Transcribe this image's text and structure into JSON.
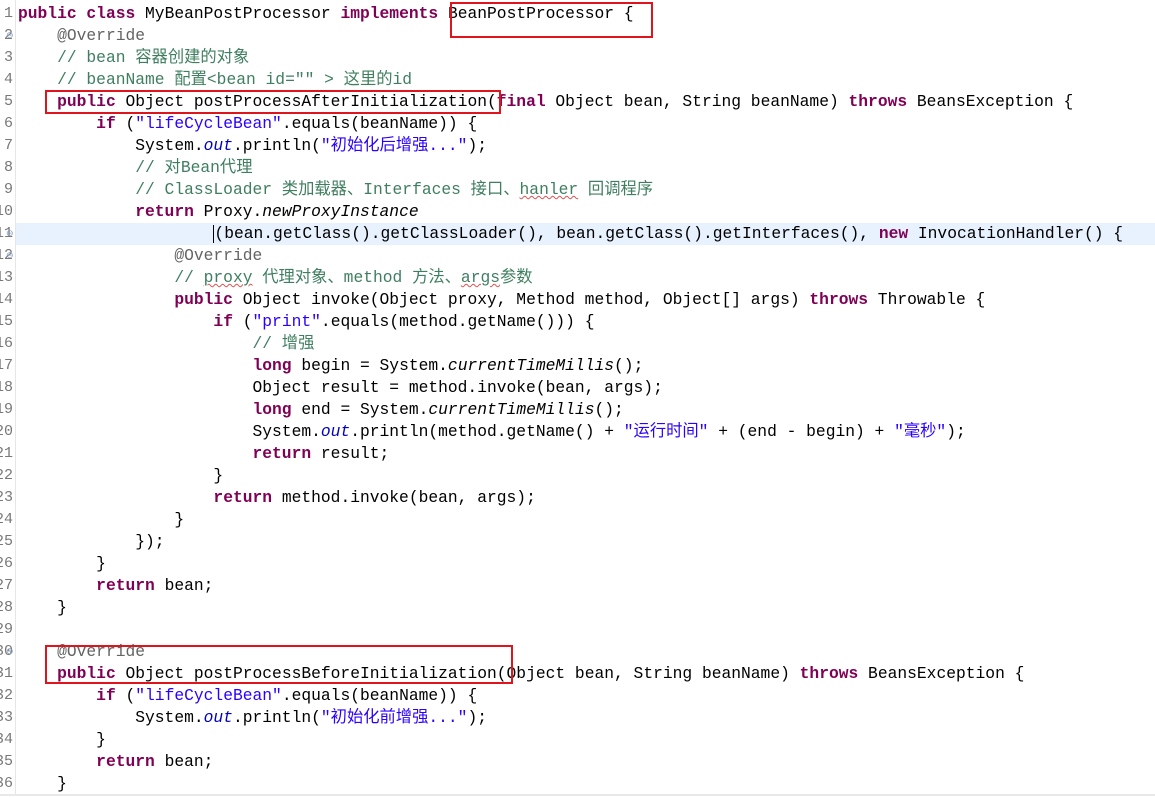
{
  "editor": {
    "current_line": 11,
    "colors": {
      "keyword": "#7f0055",
      "string": "#2a00ff",
      "comment": "#3f7f5f",
      "annotation": "#646464",
      "field": "#0000c0",
      "highlight_box": "#e0141c",
      "current_line_bg": "#e8f2fe"
    },
    "fold_lines": [
      2,
      11,
      12,
      30
    ],
    "lines": [
      {
        "n": "1",
        "t": [
          [
            "k",
            "public"
          ],
          [
            "t",
            " "
          ],
          [
            "k",
            "class"
          ],
          [
            "t",
            " MyBeanPostProcessor "
          ],
          [
            "k",
            "implements"
          ],
          [
            "t",
            " BeanPostProcessor {"
          ]
        ]
      },
      {
        "n": "2",
        "t": [
          [
            "t",
            "    "
          ],
          [
            "a",
            "@Override"
          ]
        ]
      },
      {
        "n": "3",
        "t": [
          [
            "t",
            "    "
          ],
          [
            "c",
            "// bean 容器创建的对象"
          ]
        ]
      },
      {
        "n": "4",
        "t": [
          [
            "t",
            "    "
          ],
          [
            "c",
            "// beanName 配置<bean id=\"\" > 这里的id"
          ]
        ]
      },
      {
        "n": "5",
        "t": [
          [
            "t",
            "    "
          ],
          [
            "k",
            "public"
          ],
          [
            "t",
            " Object postProcessAfterInitialization("
          ],
          [
            "k",
            "final"
          ],
          [
            "t",
            " Object bean, String beanName) "
          ],
          [
            "k",
            "throws"
          ],
          [
            "t",
            " BeansException {"
          ]
        ]
      },
      {
        "n": "6",
        "t": [
          [
            "t",
            "        "
          ],
          [
            "k",
            "if"
          ],
          [
            "t",
            " ("
          ],
          [
            "s",
            "\"lifeCycleBean\""
          ],
          [
            "t",
            ".equals(beanName)) {"
          ]
        ]
      },
      {
        "n": "7",
        "t": [
          [
            "t",
            "            System."
          ],
          [
            "f",
            "out"
          ],
          [
            "t",
            ".println("
          ],
          [
            "s",
            "\"初始化后增强...\""
          ],
          [
            "t",
            ");"
          ]
        ]
      },
      {
        "n": "8",
        "t": [
          [
            "t",
            "            "
          ],
          [
            "c",
            "// 对Bean代理"
          ]
        ]
      },
      {
        "n": "9",
        "t": [
          [
            "t",
            "            "
          ],
          [
            "c",
            "// ClassLoader 类加载器、Interfaces 接口、"
          ],
          [
            "typo",
            "hanler"
          ],
          [
            "c",
            " 回调程序"
          ]
        ]
      },
      {
        "n": "10",
        "t": [
          [
            "t",
            "            "
          ],
          [
            "k",
            "return"
          ],
          [
            "t",
            " Proxy."
          ],
          [
            "m",
            "newProxyInstance"
          ]
        ]
      },
      {
        "n": "11",
        "t": [
          [
            "t",
            "                    "
          ],
          [
            "caret",
            ""
          ],
          [
            "t",
            "(bean.getClass().getClassLoader(), bean.getClass().getInterfaces(), "
          ],
          [
            "k",
            "new"
          ],
          [
            "t",
            " InvocationHandler() {"
          ]
        ]
      },
      {
        "n": "12",
        "t": [
          [
            "t",
            "                "
          ],
          [
            "a",
            "@Override"
          ]
        ]
      },
      {
        "n": "13",
        "t": [
          [
            "t",
            "                "
          ],
          [
            "c",
            "// "
          ],
          [
            "typo",
            "proxy"
          ],
          [
            "c",
            " 代理对象、method 方法、"
          ],
          [
            "typo",
            "args"
          ],
          [
            "c",
            "参数"
          ]
        ]
      },
      {
        "n": "14",
        "t": [
          [
            "t",
            "                "
          ],
          [
            "k",
            "public"
          ],
          [
            "t",
            " Object invoke(Object proxy, Method method, Object[] args) "
          ],
          [
            "k",
            "throws"
          ],
          [
            "t",
            " Throwable {"
          ]
        ]
      },
      {
        "n": "15",
        "t": [
          [
            "t",
            "                    "
          ],
          [
            "k",
            "if"
          ],
          [
            "t",
            " ("
          ],
          [
            "s",
            "\"print\""
          ],
          [
            "t",
            ".equals(method.getName())) {"
          ]
        ]
      },
      {
        "n": "16",
        "t": [
          [
            "t",
            "                        "
          ],
          [
            "c",
            "// 增强"
          ]
        ]
      },
      {
        "n": "17",
        "t": [
          [
            "t",
            "                        "
          ],
          [
            "k",
            "long"
          ],
          [
            "t",
            " begin = System."
          ],
          [
            "m",
            "currentTimeMillis"
          ],
          [
            "t",
            "();"
          ]
        ]
      },
      {
        "n": "18",
        "t": [
          [
            "t",
            "                        Object result = method.invoke(bean, args);"
          ]
        ]
      },
      {
        "n": "19",
        "t": [
          [
            "t",
            "                        "
          ],
          [
            "k",
            "long"
          ],
          [
            "t",
            " end = System."
          ],
          [
            "m",
            "currentTimeMillis"
          ],
          [
            "t",
            "();"
          ]
        ]
      },
      {
        "n": "20",
        "t": [
          [
            "t",
            "                        System."
          ],
          [
            "f",
            "out"
          ],
          [
            "t",
            ".println(method.getName() + "
          ],
          [
            "s",
            "\"运行时间\""
          ],
          [
            "t",
            " + (end - begin) + "
          ],
          [
            "s",
            "\"毫秒\""
          ],
          [
            "t",
            ");"
          ]
        ]
      },
      {
        "n": "21",
        "t": [
          [
            "t",
            "                        "
          ],
          [
            "k",
            "return"
          ],
          [
            "t",
            " result;"
          ]
        ]
      },
      {
        "n": "22",
        "t": [
          [
            "t",
            "                    }"
          ]
        ]
      },
      {
        "n": "23",
        "t": [
          [
            "t",
            "                    "
          ],
          [
            "k",
            "return"
          ],
          [
            "t",
            " method.invoke(bean, args);"
          ]
        ]
      },
      {
        "n": "24",
        "t": [
          [
            "t",
            "                }"
          ]
        ]
      },
      {
        "n": "25",
        "t": [
          [
            "t",
            "            });"
          ]
        ]
      },
      {
        "n": "26",
        "t": [
          [
            "t",
            "        }"
          ]
        ]
      },
      {
        "n": "27",
        "t": [
          [
            "t",
            "        "
          ],
          [
            "k",
            "return"
          ],
          [
            "t",
            " bean;"
          ]
        ]
      },
      {
        "n": "28",
        "t": [
          [
            "t",
            "    }"
          ]
        ]
      },
      {
        "n": "29",
        "t": []
      },
      {
        "n": "30",
        "t": [
          [
            "t",
            "    "
          ],
          [
            "a",
            "@Override"
          ]
        ]
      },
      {
        "n": "31",
        "t": [
          [
            "t",
            "    "
          ],
          [
            "k",
            "public"
          ],
          [
            "t",
            " Object postProcessBeforeInitialization(Object bean, String beanName) "
          ],
          [
            "k",
            "throws"
          ],
          [
            "t",
            " BeansException {"
          ]
        ]
      },
      {
        "n": "32",
        "t": [
          [
            "t",
            "        "
          ],
          [
            "k",
            "if"
          ],
          [
            "t",
            " ("
          ],
          [
            "s",
            "\"lifeCycleBean\""
          ],
          [
            "t",
            ".equals(beanName)) {"
          ]
        ]
      },
      {
        "n": "33",
        "t": [
          [
            "t",
            "            System."
          ],
          [
            "f",
            "out"
          ],
          [
            "t",
            ".println("
          ],
          [
            "s",
            "\"初始化前增强...\""
          ],
          [
            "t",
            ");"
          ]
        ]
      },
      {
        "n": "34",
        "t": [
          [
            "t",
            "        }"
          ]
        ]
      },
      {
        "n": "35",
        "t": [
          [
            "t",
            "        "
          ],
          [
            "k",
            "return"
          ],
          [
            "t",
            " bean;"
          ]
        ]
      },
      {
        "n": "36",
        "t": [
          [
            "t",
            "    }"
          ]
        ]
      }
    ]
  }
}
